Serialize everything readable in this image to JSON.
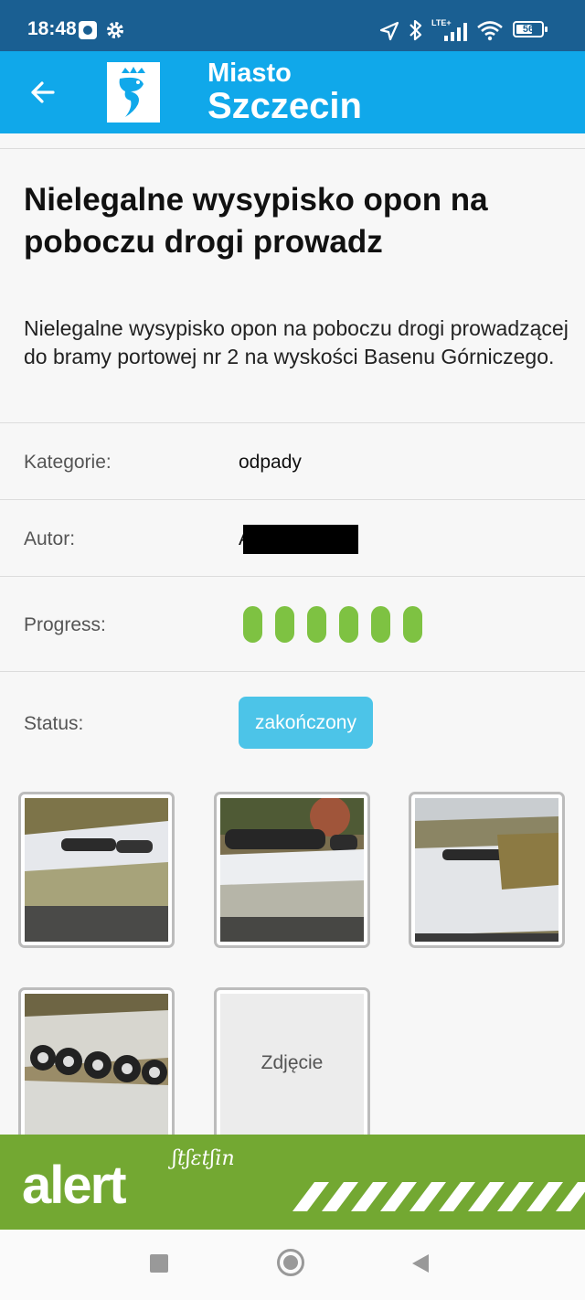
{
  "status_bar": {
    "time": "18:48",
    "battery": "56",
    "network": "LTE+",
    "icons": [
      "camera-icon",
      "gear-icon",
      "location-arrow-icon",
      "bluetooth-icon",
      "signal-icon",
      "wifi-icon",
      "battery-icon"
    ],
    "color": "#1a5f92"
  },
  "app_bar": {
    "brand_top": "Miasto",
    "brand_bottom": "Szczecin",
    "color": "#10a8ea",
    "back_icon": "back-arrow-icon"
  },
  "report": {
    "title": "Nielegalne wysypisko opon na poboczu drogi prowadz",
    "description": "Nielegalne wysypisko opon na poboczu drogi prowadzącej do bramy portowej nr 2 na wyskości Basenu Górniczego.",
    "category_label": "Kategorie:",
    "category_value": "odpady",
    "author_label": "Autor:",
    "author_value": "A",
    "progress_label": "Progress:",
    "progress_filled": 6,
    "progress_total": 6,
    "progress_color": "#7ec242",
    "status_label": "Status:",
    "status_value": "zakończony",
    "status_color": "#4cc4e8"
  },
  "photos": {
    "add_label": "Zdjęcie"
  },
  "banner": {
    "text": "alert",
    "subtext": "ʃtʃɛtʃin",
    "color": "#73a832"
  },
  "nav_bar": {
    "icons": [
      "recent-apps-icon",
      "home-icon",
      "back-icon"
    ]
  }
}
